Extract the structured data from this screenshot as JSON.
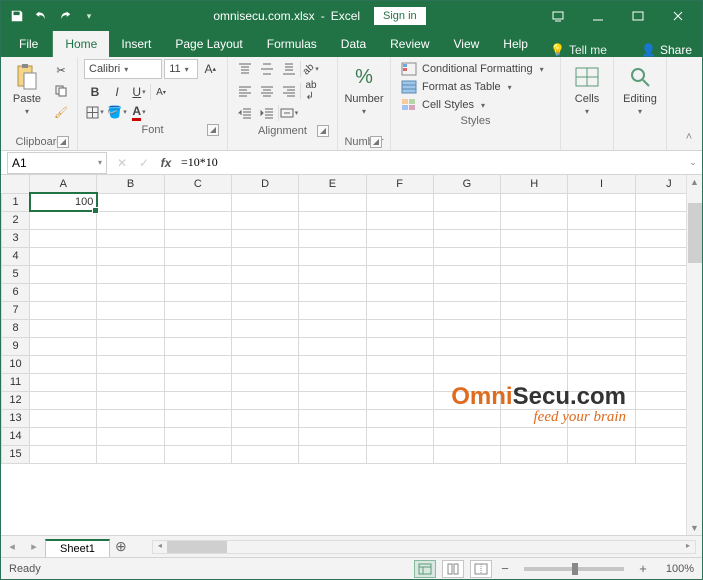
{
  "title": {
    "filename": "omnisecu.com.xlsx",
    "app": "Excel",
    "signin": "Sign in"
  },
  "tabs": {
    "file": "File",
    "home": "Home",
    "insert": "Insert",
    "pagelayout": "Page Layout",
    "formulas": "Formulas",
    "data": "Data",
    "review": "Review",
    "view": "View",
    "help": "Help",
    "tellme": "Tell me",
    "share": "Share"
  },
  "ribbon": {
    "clipboard": {
      "label": "Clipboard",
      "paste": "Paste"
    },
    "font": {
      "label": "Font",
      "name": "Calibri",
      "size": "11"
    },
    "alignment": {
      "label": "Alignment"
    },
    "number": {
      "label": "Number",
      "btn": "Number"
    },
    "styles": {
      "label": "Styles",
      "cond": "Conditional Formatting",
      "table": "Format as Table",
      "cell": "Cell Styles"
    },
    "cells": {
      "label": "Cells",
      "btn": "Cells"
    },
    "editing": {
      "label": "Editing",
      "btn": "Editing"
    }
  },
  "fx": {
    "name": "A1",
    "formula": "=10*10"
  },
  "columns": [
    "A",
    "B",
    "C",
    "D",
    "E",
    "F",
    "G",
    "H",
    "I",
    "J"
  ],
  "rows": [
    "1",
    "2",
    "3",
    "4",
    "5",
    "6",
    "7",
    "8",
    "9",
    "10",
    "11",
    "12",
    "13",
    "14",
    "15"
  ],
  "cells": {
    "A1": "100"
  },
  "brand": {
    "line1a": "Omni",
    "line1b": "Secu.com",
    "line2": "feed your brain"
  },
  "sheet": {
    "name": "Sheet1"
  },
  "status": {
    "ready": "Ready",
    "zoom": "100%"
  }
}
